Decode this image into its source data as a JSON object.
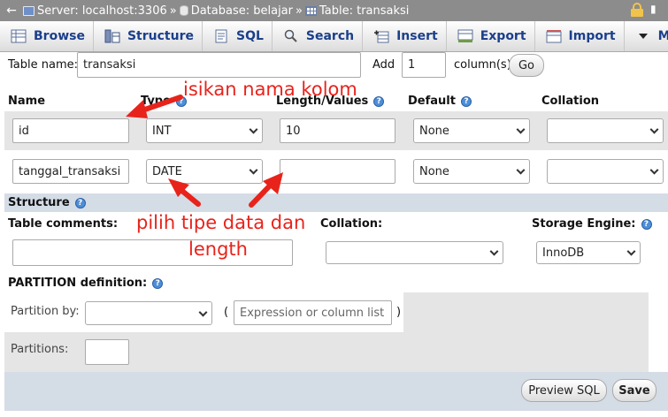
{
  "breadcrumb": {
    "server": "Server: localhost:3306",
    "database": "Database: belajar",
    "table": "Table: transaksi",
    "separator": "»"
  },
  "tabs": [
    {
      "label": "Browse",
      "icon": "browse-icon"
    },
    {
      "label": "Structure",
      "icon": "structure-icon"
    },
    {
      "label": "SQL",
      "icon": "sql-icon"
    },
    {
      "label": "Search",
      "icon": "search-icon"
    },
    {
      "label": "Insert",
      "icon": "insert-icon"
    },
    {
      "label": "Export",
      "icon": "export-icon"
    },
    {
      "label": "Import",
      "icon": "import-icon"
    },
    {
      "label": "More",
      "icon": "caret-down-icon"
    }
  ],
  "table_name": {
    "label": "Table name:",
    "value": "transaksi",
    "add_label": "Add",
    "add_value": "1",
    "columns_label": "column(s)",
    "go_label": "Go"
  },
  "columns_header": {
    "name": "Name",
    "type": "Type",
    "length": "Length/Values",
    "default": "Default",
    "collation": "Collation"
  },
  "rows": [
    {
      "name": "id",
      "type": "INT",
      "length": "10",
      "default": "None",
      "collation": ""
    },
    {
      "name": "tanggal_transaksi",
      "type": "DATE",
      "length": "",
      "default": "None",
      "collation": ""
    }
  ],
  "structure": {
    "title": "Structure",
    "table_comments_label": "Table comments:",
    "collation_label": "Collation:",
    "storage_engine_label": "Storage Engine:",
    "storage_engine_value": "InnoDB"
  },
  "partition": {
    "title": "PARTITION definition:",
    "partition_by_label": "Partition by:",
    "expression_placeholder": "Expression or column list",
    "open_paren": "(",
    "close_paren": ")",
    "partitions_label": "Partitions:"
  },
  "actions": {
    "preview_sql": "Preview SQL",
    "save": "Save"
  },
  "annotations": {
    "name_hint": "isikan nama kolom",
    "type_hint_line1": "pilih tipe data dan",
    "type_hint_line2": "length",
    "color": "#e8231b"
  },
  "colors": {
    "topbar": "#8c8c8c",
    "tab_text": "#1b3f8c",
    "row_bg": "#e5e5e5",
    "band_bg": "#d4dce6",
    "help_icon": "#4d8fd8"
  }
}
